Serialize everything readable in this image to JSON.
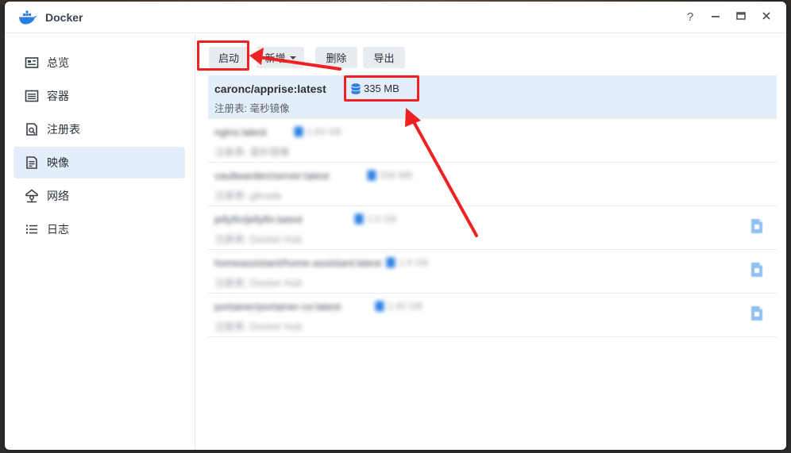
{
  "window": {
    "title": "Docker",
    "controls": {
      "help": "?",
      "minimize": "−",
      "maximize": "□",
      "close": "✕"
    }
  },
  "sidebar": {
    "items": [
      {
        "label": "总览",
        "icon": "overview-icon",
        "active": false
      },
      {
        "label": "容器",
        "icon": "container-icon",
        "active": false
      },
      {
        "label": "注册表",
        "icon": "registry-search-icon",
        "active": false
      },
      {
        "label": "映像",
        "icon": "image-icon",
        "active": true
      },
      {
        "label": "网络",
        "icon": "network-icon",
        "active": false
      },
      {
        "label": "日志",
        "icon": "log-list-icon",
        "active": false
      }
    ]
  },
  "toolbar": {
    "launch_label": "启动",
    "add_label": "新增",
    "delete_label": "删除",
    "export_label": "导出"
  },
  "images": [
    {
      "name": "caronc/apprise:latest",
      "size": "335 MB",
      "registry_label": "注册表:",
      "registry": "毫秒镜像",
      "selected": true,
      "blurred": false
    },
    {
      "name": "nginx:latest",
      "size": "1.83 GB",
      "registry_label": "注册表:",
      "registry": "毫秒镜像",
      "selected": false,
      "blurred": true
    },
    {
      "name": "vaultwarden/server:latest",
      "size": "338 MB",
      "registry_label": "注册表:",
      "registry": "gitcode",
      "selected": false,
      "blurred": true
    },
    {
      "name": "jellyfin/jellyfin:latest",
      "size": "1.5 GB",
      "registry_label": "注册表:",
      "registry": "Docker Hub",
      "selected": false,
      "blurred": true,
      "update": true
    },
    {
      "name": "homeassistant/home-assistant:latest",
      "size": "1.6 GB",
      "registry_label": "注册表:",
      "registry": "Docker Hub",
      "selected": false,
      "blurred": true,
      "update": true
    },
    {
      "name": "portainer/portainer-ce:latest",
      "size": "1.65 GB",
      "registry_label": "注册表:",
      "registry": "Docker Hub",
      "selected": false,
      "blurred": true,
      "update": true
    }
  ],
  "colors": {
    "accent": "#2a7ee3",
    "selected_bg": "#e4eefa",
    "highlight": "#ee2222"
  }
}
